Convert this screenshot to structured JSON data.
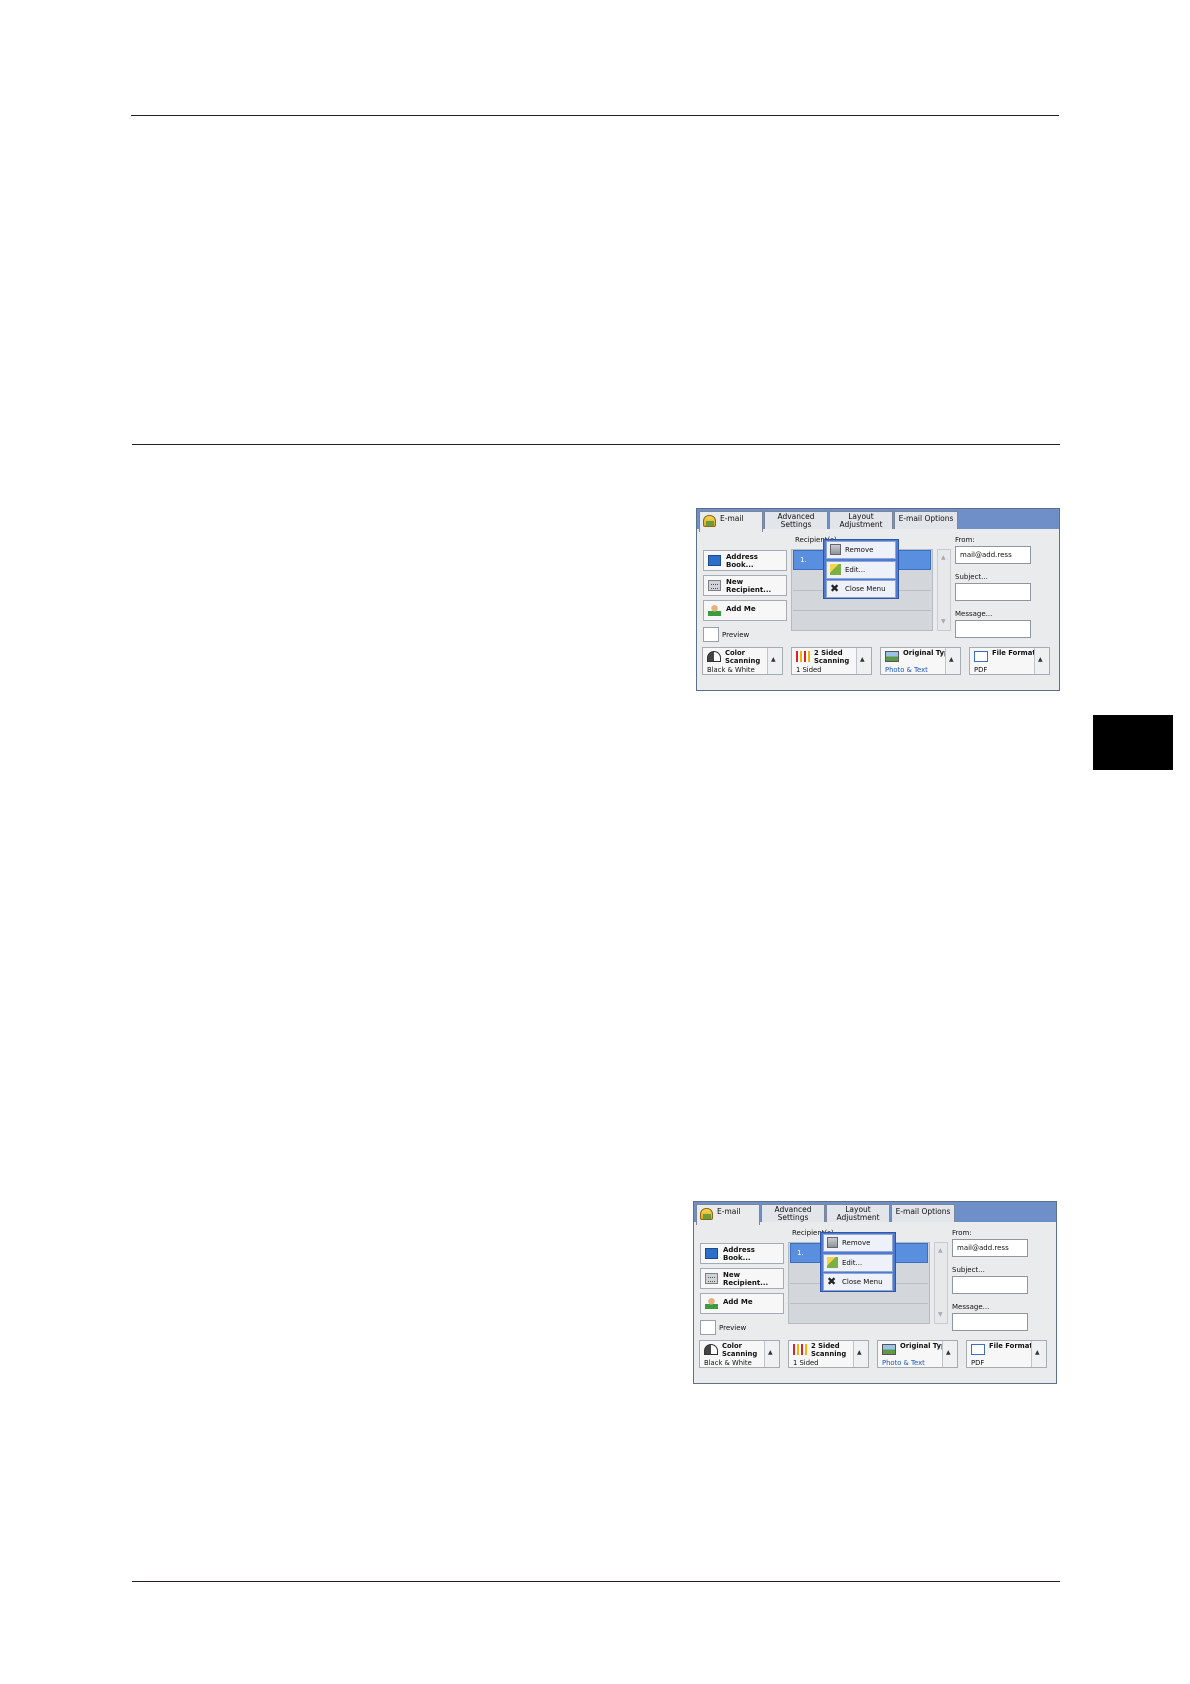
{
  "panels": [
    {
      "tabs": [
        "E-mail",
        "Advanced Settings",
        "Layout Adjustment",
        "E-mail Options"
      ],
      "left_buttons": [
        "Address Book...",
        "New Recipient...",
        "Add Me"
      ],
      "preview_label": "Preview",
      "recipients_label": "Recipient(s)",
      "recipient_row": "1.",
      "context_menu": [
        "Remove",
        "Edit...",
        "Close Menu"
      ],
      "from_label": "From:",
      "from_value": "mail@add.ress",
      "subject_label": "Subject...",
      "message_label": "Message...",
      "bottom_buttons": [
        {
          "title": "Color Scanning",
          "value": "Black & White"
        },
        {
          "title": "2 Sided Scanning",
          "value": "1 Sided"
        },
        {
          "title": "Original Type",
          "value": "Photo & Text"
        },
        {
          "title": "File Format",
          "value": "PDF"
        }
      ]
    },
    {
      "tabs": [
        "E-mail",
        "Advanced Settings",
        "Layout Adjustment",
        "E-mail Options"
      ],
      "left_buttons": [
        "Address Book...",
        "New Recipient...",
        "Add Me"
      ],
      "preview_label": "Preview",
      "recipients_label": "Recipient(s)",
      "recipient_row": "1.",
      "context_menu": [
        "Remove",
        "Edit...",
        "Close Menu"
      ],
      "from_label": "From:",
      "from_value": "mail@add.ress",
      "subject_label": "Subject...",
      "message_label": "Message...",
      "bottom_buttons": [
        {
          "title": "Color Scanning",
          "value": "Black & White"
        },
        {
          "title": "2 Sided Scanning",
          "value": "1 Sided"
        },
        {
          "title": "Original Type",
          "value": "Photo & Text"
        },
        {
          "title": "File Format",
          "value": "PDF"
        }
      ]
    }
  ]
}
